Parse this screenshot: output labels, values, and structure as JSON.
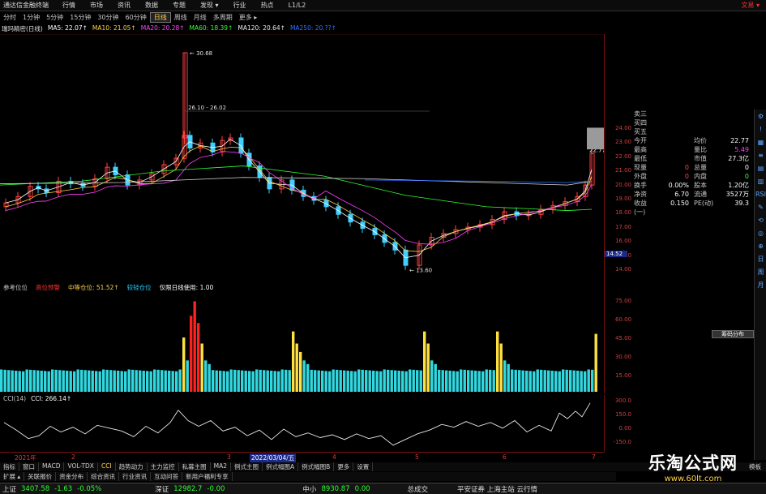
{
  "app": {
    "name": "通达信金融终端",
    "trade": "文易 ▾"
  },
  "menu": [
    "行情",
    "市场",
    "资讯",
    "数据",
    "专题",
    "发现 ▾",
    "行业",
    "热点",
    "L1/L2"
  ],
  "periods": [
    "分时",
    "1分钟",
    "5分钟",
    "15分钟",
    "30分钟",
    "60分钟",
    "日线",
    "周线",
    "月线",
    "多周期",
    "更多 ▸"
  ],
  "active_period": 6,
  "stock": {
    "title": "瑞玛精密(日线)"
  },
  "ma_legend": [
    {
      "text": "MA5: 22.07↑",
      "color": "#ffffff"
    },
    {
      "text": "MA10: 21.05↑",
      "color": "#ffd24a"
    },
    {
      "text": "MA20: 20.28↑",
      "color": "#ff40ff"
    },
    {
      "text": "MA60: 18.39↑",
      "color": "#30ff30"
    },
    {
      "text": "MA120: 20.64↑",
      "color": "#e8e8e8"
    },
    {
      "text": "MA250: 20.??↑",
      "color": "#3070ff"
    }
  ],
  "price_annotations": {
    "high": "30.68",
    "range": "26.10 - 26.02",
    "low": "13.60",
    "last": "22.77",
    "cursor": "14.52"
  },
  "price_axis": [
    "24.00",
    "23.00",
    "22.00",
    "21.00",
    "20.00",
    "19.00",
    "18.00",
    "17.00",
    "16.00",
    "15.00",
    "14.00"
  ],
  "quote": {
    "asks": [
      "卖三",
      "买四",
      "买五"
    ],
    "rows": [
      {
        "k1": "今开",
        "v1": "",
        "k2": "均价",
        "v2": "22.77",
        "c1": "#ffffff",
        "c2": "#ffffff"
      },
      {
        "k1": "最高",
        "v1": "",
        "k2": "量比",
        "v2": "5.49",
        "c1": "#ff4040",
        "c2": "#ff40ff"
      },
      {
        "k1": "最低",
        "v1": "",
        "k2": "市值",
        "v2": "27.3亿",
        "c1": "#30ff30",
        "c2": "#ffffff"
      },
      {
        "k1": "现量",
        "v1": "0",
        "k2": "总量",
        "v2": "0",
        "c1": "#ff4040",
        "c2": "#ffffff"
      },
      {
        "k1": "外盘",
        "v1": "0",
        "k2": "内盘",
        "v2": "0",
        "c1": "#ff4040",
        "c2": "#30ff30"
      },
      {
        "k1": "换手",
        "v1": "0.00%",
        "k2": "股本",
        "v2": "1.20亿",
        "c1": "#ffffff",
        "c2": "#ffffff"
      },
      {
        "k1": "净资",
        "v1": "6.70",
        "k2": "流通",
        "v2": "3527万",
        "c1": "#ffffff",
        "c2": "#ffffff"
      },
      {
        "k1": "收益(一)",
        "v1": "0.150",
        "k2": "PE(动)",
        "v2": "39.3",
        "c1": "#ffffff",
        "c2": "#ffffff"
      }
    ]
  },
  "ind1": {
    "title": "参考位位",
    "legend": [
      {
        "text": "高位预警",
        "color": "#ff3030"
      },
      {
        "text": "中等仓位: 51.52↑",
        "color": "#ffd24a"
      },
      {
        "text": "较轻仓位",
        "color": "#30d0ff"
      },
      {
        "text": "仅限日线使用: 1.00",
        "color": "#ffffff"
      }
    ],
    "axis": [
      "75.00",
      "60.00",
      "45.00",
      "30.00",
      "15.00"
    ]
  },
  "ind2": {
    "legend": [
      {
        "text": "CCI(14)",
        "color": "#c8c8c8"
      },
      {
        "text": "CCI: 266.14↑",
        "color": "#ffffff"
      }
    ],
    "axis": [
      "300.0",
      "150.0",
      "0.00",
      "-150.0"
    ]
  },
  "time_axis": [
    {
      "text": "2021年",
      "hl": false
    },
    {
      "text": "2",
      "hl": false
    },
    {
      "text": "3",
      "hl": false
    },
    {
      "text": "2022/03/04/五",
      "hl": true
    },
    {
      "text": "4",
      "hl": false
    },
    {
      "text": "5",
      "hl": false
    },
    {
      "text": "6",
      "hl": false
    },
    {
      "text": "7",
      "hl": false
    }
  ],
  "ind_tabs": [
    "指标",
    "窗口",
    "MACD",
    "VOL-TDX",
    "CCI",
    "趋势动力",
    "主力监控",
    "私募主图",
    "MA2",
    "例式主图",
    "例式幅图A",
    "例式幅图B",
    "更多",
    "设置"
  ],
  "ind_tabs_selected": 4,
  "ind_tabs_right": "模板",
  "sub_tabs": [
    "扩展 ▴",
    "关联报价",
    "资金分布",
    "综合资讯",
    "行业资讯",
    "互动问答",
    "新用户福利专享"
  ],
  "status": {
    "sh_name": "上证",
    "sh_value": "3407.58",
    "sh_chg": "-1.63",
    "sh_pct": "-0.05%",
    "sz_name": "深证",
    "sz_value": "12982.7",
    "sz_chg": "-0.00",
    "zx_name": "中小",
    "zx_value": "8930.87",
    "zx_chg": "0.00",
    "turnover_label": "总成交",
    "broker": "平安证券 上海主站 云行情"
  },
  "sidebar_icons": [
    "settings-icon",
    "alert-icon",
    "layout-icon",
    "list-icon",
    "grid-icon",
    "chart-icon",
    "rsi-icon",
    "draw-icon",
    "scan-icon",
    "cursor-icon",
    "zoom-icon",
    "news-icon",
    "F10-icon",
    "info-icon"
  ],
  "sidebar_labels": [
    "⚙",
    "!",
    "▦",
    "≡",
    "▤",
    "▥",
    "RSI",
    "✎",
    "⟲",
    "◎",
    "⊕",
    "日",
    "周",
    "月"
  ],
  "chip": "筹码分布",
  "watermark": {
    "cn": "乐淘公式网",
    "url": "www.60lt.com"
  },
  "chart_data": {
    "type": "candlestick",
    "series": [
      {
        "name": "MA5",
        "color": "#ffffff"
      },
      {
        "name": "MA10",
        "color": "#ffd24a"
      },
      {
        "name": "MA20",
        "color": "#ff40ff"
      },
      {
        "name": "MA60",
        "color": "#30ff30"
      },
      {
        "name": "MA120",
        "color": "#e8e8e8"
      },
      {
        "name": "MA250",
        "color": "#3070ff"
      }
    ],
    "ylim": [
      13.5,
      31
    ],
    "position_bars": {
      "ylim": [
        0,
        80
      ]
    },
    "cci": {
      "ylim": [
        -250,
        350
      ]
    }
  }
}
